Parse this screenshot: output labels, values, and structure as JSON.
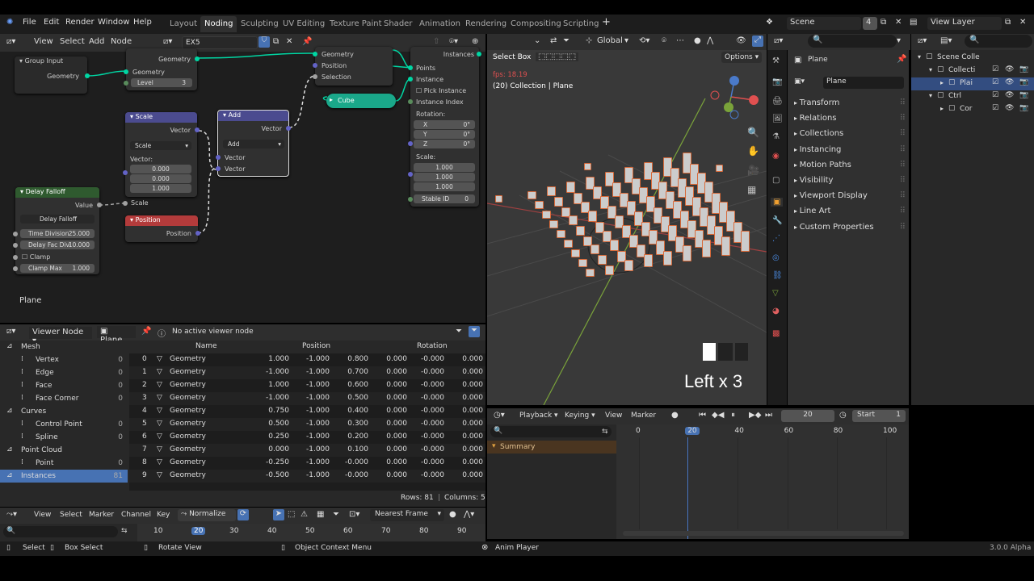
{
  "menubar": {
    "items": [
      "File",
      "Edit",
      "Render",
      "Window",
      "Help"
    ]
  },
  "workspaces": {
    "tabs": [
      "Layout",
      "Noding",
      "Sculpting",
      "UV Editing",
      "Texture Paint",
      "Shader",
      "Animation",
      "Rendering",
      "Compositing",
      "Scripting"
    ],
    "active": "Noding",
    "add": "+"
  },
  "scene": {
    "name": "Scene",
    "count": "4",
    "view_layer": "View Layer"
  },
  "node_editor": {
    "menu": [
      "View",
      "Select",
      "Add",
      "Node"
    ],
    "tree_name": "EX5",
    "object_label": "Plane",
    "nodes": {
      "group_input": {
        "title": "Group Input",
        "outputs": [
          "Geometry"
        ]
      },
      "level_node": {
        "outputs": [
          "Geometry"
        ],
        "inputs": [
          "Geometry"
        ],
        "level_label": "Level",
        "level_value": "3"
      },
      "scale": {
        "title": "Scale",
        "output": "Vector",
        "mode": "Scale",
        "vector_label": "Vector:",
        "vector": [
          "0.000",
          "0.000",
          "1.000"
        ],
        "scale_label": "Scale"
      },
      "add": {
        "title": "Add",
        "output": "Vector",
        "mode": "Add",
        "inputs": [
          "Vector",
          "Vector"
        ]
      },
      "instance": {
        "outputs": [
          "Instances"
        ],
        "inputs": [
          "Points",
          "Instance"
        ],
        "pick_instance": "Pick Instance",
        "instance_index": "Instance Index",
        "rotation_label": "Rotation:",
        "rotation": [
          {
            "axis": "X",
            "val": "0°"
          },
          {
            "axis": "Y",
            "val": "0°"
          },
          {
            "axis": "Z",
            "val": "0°"
          }
        ],
        "scale_label": "Scale:",
        "scale": [
          "1.000",
          "1.000",
          "1.000"
        ],
        "stable_id": "Stable ID",
        "stable_id_val": "0"
      },
      "sel": {
        "outputs": [
          "Geometry",
          "Position",
          "Selection"
        ]
      },
      "cube": {
        "title": "Cube"
      },
      "delay": {
        "title": "Delay Falloff",
        "output": "Value",
        "group_name": "Delay Falloff",
        "fields": [
          {
            "label": "Time Division",
            "val": "25.000"
          },
          {
            "label": "Delay Fac Divi",
            "val": "10.000"
          }
        ],
        "clamp": "Clamp",
        "clamp_max": "Clamp Max",
        "clamp_max_val": "1.000"
      },
      "position": {
        "title": "Position",
        "output": "Position"
      }
    }
  },
  "viewport": {
    "mode": "Global",
    "select_box": "Select Box",
    "options": "Options",
    "fps": "fps: 18.19",
    "collection": "(20) Collection | Plane",
    "key_overlay": "Left x 3"
  },
  "properties": {
    "object": "Plane",
    "data_name": "Plane",
    "sections": [
      "Transform",
      "Relations",
      "Collections",
      "Instancing",
      "Motion Paths",
      "Visibility",
      "Viewport Display",
      "Line Art",
      "Custom Properties"
    ]
  },
  "outliner": {
    "items": [
      {
        "name": "Scene Colle",
        "indent": 0
      },
      {
        "name": "Collecti",
        "indent": 1
      },
      {
        "name": "Plai",
        "indent": 2
      },
      {
        "name": "Ctrl",
        "indent": 1
      },
      {
        "name": "Cor",
        "indent": 2
      }
    ]
  },
  "spreadsheet": {
    "viewer": "Viewer Node",
    "object": "Plane",
    "message": "No active viewer node",
    "columns": [
      "Name",
      "Position",
      "Rotation"
    ],
    "domains": [
      {
        "name": "Mesh",
        "count": "",
        "indent": 0
      },
      {
        "name": "Vertex",
        "count": "0",
        "indent": 1
      },
      {
        "name": "Edge",
        "count": "0",
        "indent": 1
      },
      {
        "name": "Face",
        "count": "0",
        "indent": 1
      },
      {
        "name": "Face Corner",
        "count": "0",
        "indent": 1
      },
      {
        "name": "Curves",
        "count": "",
        "indent": 0
      },
      {
        "name": "Control Point",
        "count": "0",
        "indent": 1
      },
      {
        "name": "Spline",
        "count": "0",
        "indent": 1
      },
      {
        "name": "Point Cloud",
        "count": "",
        "indent": 0
      },
      {
        "name": "Point",
        "count": "0",
        "indent": 1
      },
      {
        "name": "Instances",
        "count": "81",
        "indent": 0
      }
    ],
    "rows": [
      {
        "i": "0",
        "name": "Geometry",
        "p": [
          "1.000",
          "-1.000",
          "0.800"
        ],
        "r": [
          "0.000",
          "-0.000",
          "0.000"
        ]
      },
      {
        "i": "1",
        "name": "Geometry",
        "p": [
          "-1.000",
          "-1.000",
          "0.700"
        ],
        "r": [
          "0.000",
          "-0.000",
          "0.000"
        ]
      },
      {
        "i": "2",
        "name": "Geometry",
        "p": [
          "1.000",
          "-1.000",
          "0.600"
        ],
        "r": [
          "0.000",
          "-0.000",
          "0.000"
        ]
      },
      {
        "i": "3",
        "name": "Geometry",
        "p": [
          "-1.000",
          "-1.000",
          "0.500"
        ],
        "r": [
          "0.000",
          "-0.000",
          "0.000"
        ]
      },
      {
        "i": "4",
        "name": "Geometry",
        "p": [
          "0.750",
          "-1.000",
          "0.400"
        ],
        "r": [
          "0.000",
          "-0.000",
          "0.000"
        ]
      },
      {
        "i": "5",
        "name": "Geometry",
        "p": [
          "0.500",
          "-1.000",
          "0.300"
        ],
        "r": [
          "0.000",
          "-0.000",
          "0.000"
        ]
      },
      {
        "i": "6",
        "name": "Geometry",
        "p": [
          "0.250",
          "-1.000",
          "0.200"
        ],
        "r": [
          "0.000",
          "-0.000",
          "0.000"
        ]
      },
      {
        "i": "7",
        "name": "Geometry",
        "p": [
          "0.000",
          "-1.000",
          "0.100"
        ],
        "r": [
          "0.000",
          "-0.000",
          "0.000"
        ]
      },
      {
        "i": "8",
        "name": "Geometry",
        "p": [
          "-0.250",
          "-1.000",
          "-0.000"
        ],
        "r": [
          "0.000",
          "-0.000",
          "0.000"
        ]
      },
      {
        "i": "9",
        "name": "Geometry",
        "p": [
          "-0.500",
          "-1.000",
          "-0.000"
        ],
        "r": [
          "0.000",
          "-0.000",
          "0.000"
        ]
      }
    ],
    "rows_info": "Rows: 81",
    "cols_info": "Columns: 5"
  },
  "timeline": {
    "menu": [
      "Playback",
      "Keying",
      "View",
      "Marker"
    ],
    "frame": "20",
    "start_label": "Start",
    "start": "1",
    "summary": "Summary",
    "ticks": [
      "0",
      "20",
      "40",
      "60",
      "80",
      "100"
    ]
  },
  "graph": {
    "menu": [
      "View",
      "Select",
      "Marker",
      "Channel",
      "Key"
    ],
    "normalize": "Normalize",
    "interp": "Nearest Frame",
    "ticks": [
      "10",
      "20",
      "30",
      "40",
      "50",
      "60",
      "70",
      "80",
      "90"
    ]
  },
  "status": {
    "items": [
      "Select",
      "Box Select",
      "Rotate View",
      "Object Context Menu"
    ],
    "anim": "Anim Player",
    "version": "3.0.0 Alpha"
  }
}
